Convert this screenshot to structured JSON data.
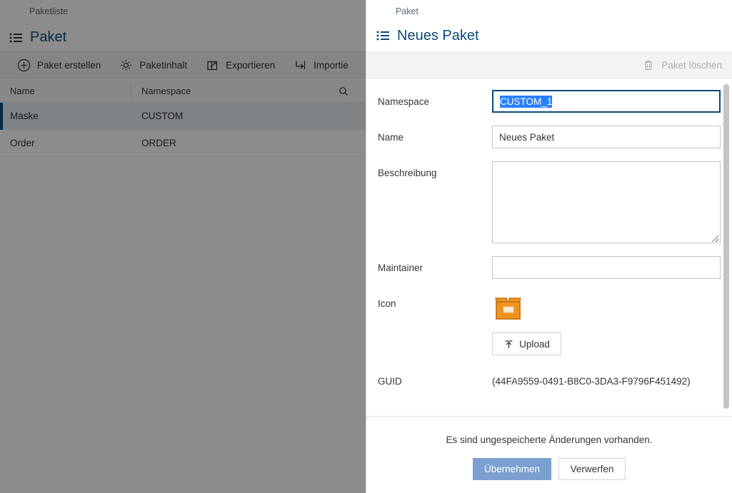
{
  "background": {
    "breadcrumb": "Paketliste",
    "title": "Paket",
    "title_icon": "list-icon",
    "toolbar": [
      {
        "label": "Paket erstellen",
        "icon": "plus-circle-icon"
      },
      {
        "label": "Paketinhalt",
        "icon": "gear-icon"
      },
      {
        "label": "Exportieren",
        "icon": "external-link-icon"
      },
      {
        "label": "Importie",
        "icon": "import-arrow-icon"
      }
    ],
    "table": {
      "columns": [
        "Name",
        "Namespace"
      ],
      "search_icon": "search-icon",
      "rows": [
        {
          "name": "Maske",
          "namespace": "CUSTOM",
          "selected": true
        },
        {
          "name": "Order",
          "namespace": "ORDER",
          "selected": false
        }
      ]
    }
  },
  "panel": {
    "breadcrumb": "Paket",
    "title": "Neues Paket",
    "title_icon": "list-icon",
    "action": {
      "label": "Paket löschen",
      "icon": "trash-icon",
      "disabled": true
    },
    "fields": {
      "namespace": {
        "label": "Namespace",
        "value": "CUSTOM_1",
        "focused": true,
        "selected": true
      },
      "name": {
        "label": "Name",
        "value": "Neues Paket"
      },
      "description": {
        "label": "Beschreibung",
        "value": "",
        "placeholder": ""
      },
      "maintainer": {
        "label": "Maintainer",
        "value": "",
        "placeholder": ""
      },
      "icon": {
        "label": "Icon",
        "image": "package-box-icon",
        "upload_label": "Upload",
        "upload_icon": "upload-icon"
      },
      "guid": {
        "label": "GUID",
        "value": "(44FA9559-0491-B8C0-3DA3-F9796F451492)"
      }
    },
    "footer": {
      "message": "Es sind ungespeicherte Änderungen vorhanden.",
      "apply_label": "Übernehmen",
      "discard_label": "Verwerfen"
    }
  },
  "colors": {
    "title_blue": "#0a4b78",
    "selection_blue": "#2a7fff",
    "primary_button": "#7b9fd0",
    "package_orange": "#f0931e",
    "package_orange_dark": "#c8741a",
    "package_label": "#f7ecd5"
  }
}
